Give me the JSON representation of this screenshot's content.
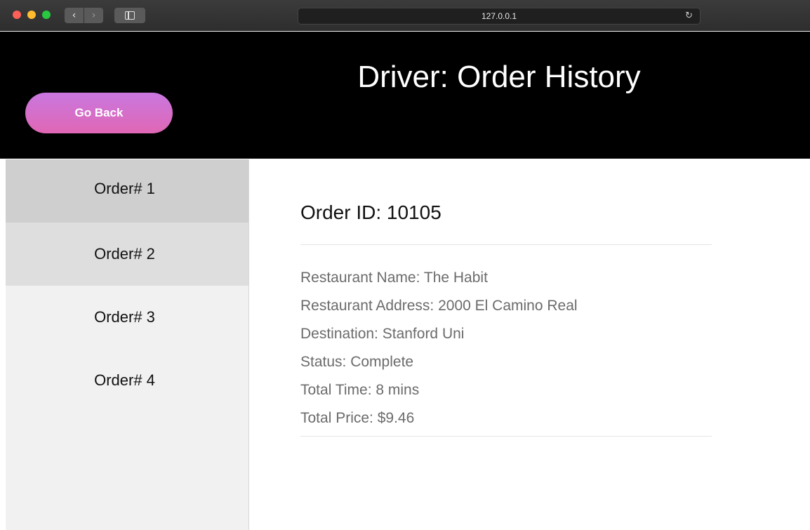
{
  "browser": {
    "url": "127.0.0.1",
    "back_glyph": "‹",
    "forward_glyph": "›",
    "reload_glyph": "↻",
    "icons": [
      "back-icon",
      "forward-icon",
      "sidebar-toggle-icon",
      "reload-icon"
    ]
  },
  "header": {
    "title": "Driver: Order History",
    "go_back_label": "Go Back"
  },
  "sidebar": {
    "items": [
      {
        "label": "Order# 1"
      },
      {
        "label": "Order# 2"
      },
      {
        "label": "Order# 3"
      },
      {
        "label": "Order# 4"
      }
    ]
  },
  "order": {
    "id_line": "Order ID: 10105",
    "fields": [
      "Restaurant Name: The Habit",
      "Restaurant Address: 2000 El Camino Real",
      "Destination: Stanford Uni",
      "Status: Complete",
      "Total Time: 8 mins",
      "Total Price: $9.46"
    ]
  },
  "colors": {
    "header_bg": "#000000",
    "button_gradient_top": "#c977e0",
    "button_gradient_bottom": "#e067b4",
    "sidebar_bg": "#f1f1f1",
    "active_item_bg": "#cfcfcf"
  }
}
